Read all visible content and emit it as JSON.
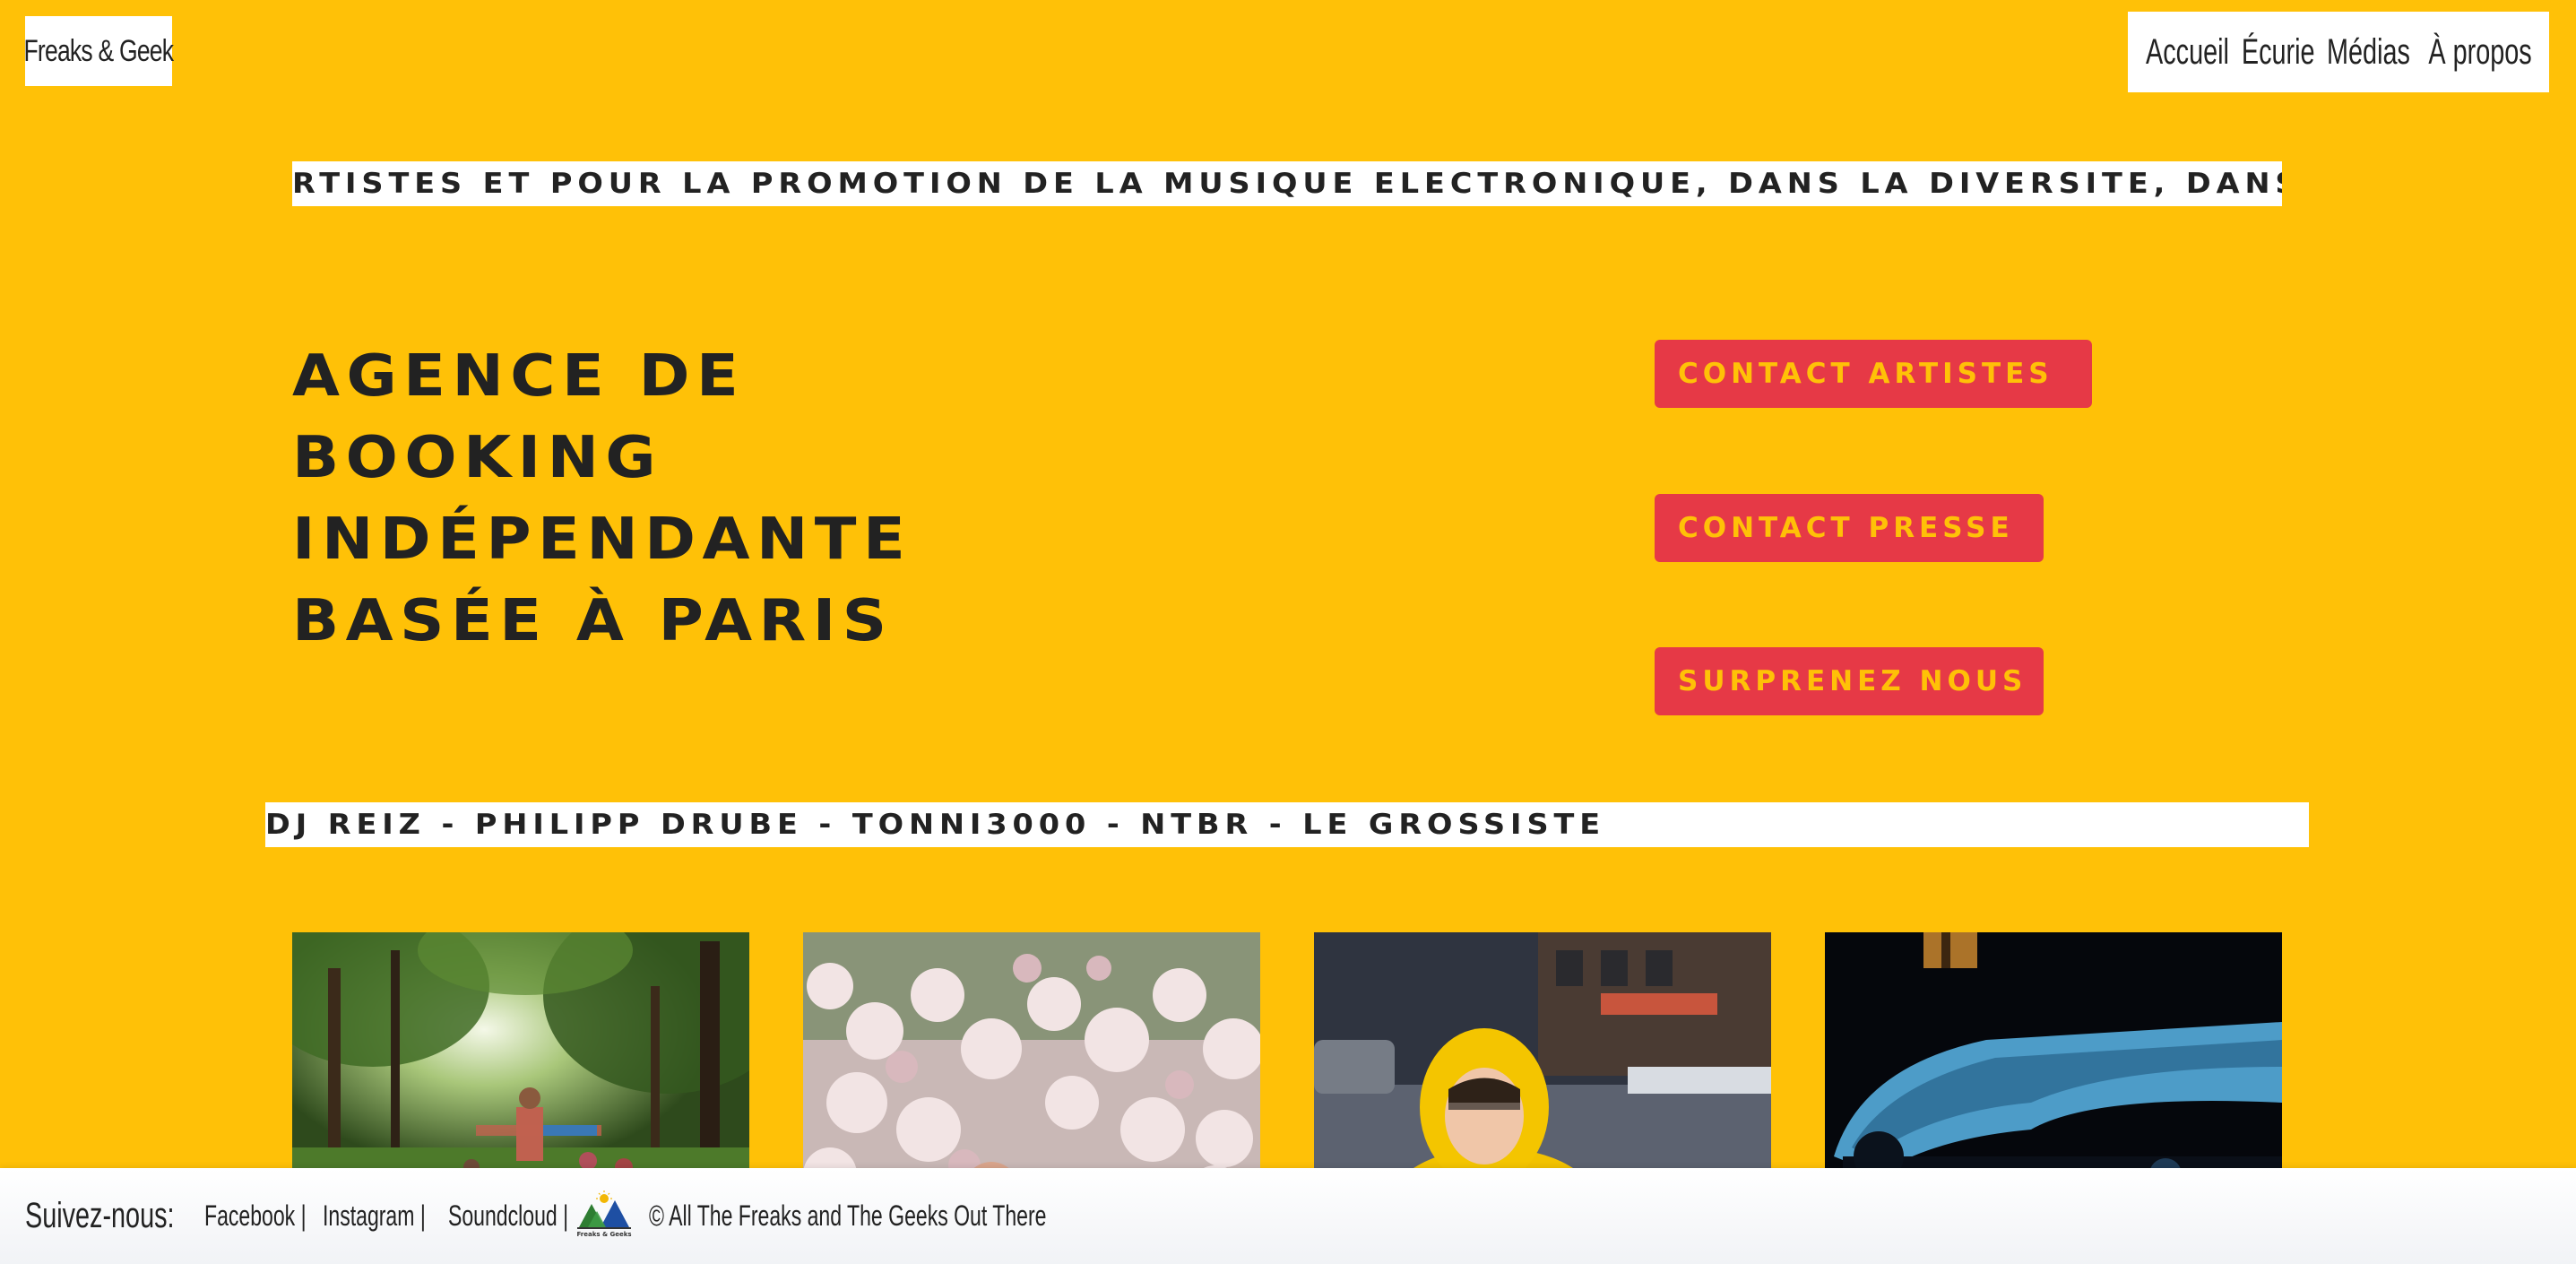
{
  "header": {
    "brand": "Freaks & Geek",
    "nav": [
      {
        "label": "Accueil"
      },
      {
        "label": "Écurie"
      },
      {
        "label": "Médias"
      },
      {
        "label": "À propos"
      }
    ]
  },
  "tickers": {
    "top": "RTISTES ET POUR LA PROMOTION DE LA MUSIQUE ELECTRONIQUE, DANS LA DIVERSITE, DANS L’OUVE",
    "bottom": "DJ REIZ - PHILIPP DRUBE - TONNI3000 - NTBR - LE GROSSISTE"
  },
  "hero": {
    "lines": [
      "Agence de",
      "booking",
      "indépendante",
      "basée à Paris"
    ]
  },
  "cta": [
    {
      "label": "Contact Artistes"
    },
    {
      "label": "Contact Presse"
    },
    {
      "label": "Surprenez Nous"
    }
  ],
  "footer": {
    "label": "Suivez-nous:",
    "links": [
      {
        "label": "Facebook |"
      },
      {
        "label": "Instagram |"
      },
      {
        "label": "Soundcloud |"
      }
    ],
    "logo_text": "Freaks & Geeks",
    "copyright": "© All The Freaks and The Geeks Out There"
  },
  "colors": {
    "background": "#FFC107",
    "accent": "#E63946",
    "text": "#222222",
    "surface": "#FFFFFF"
  }
}
